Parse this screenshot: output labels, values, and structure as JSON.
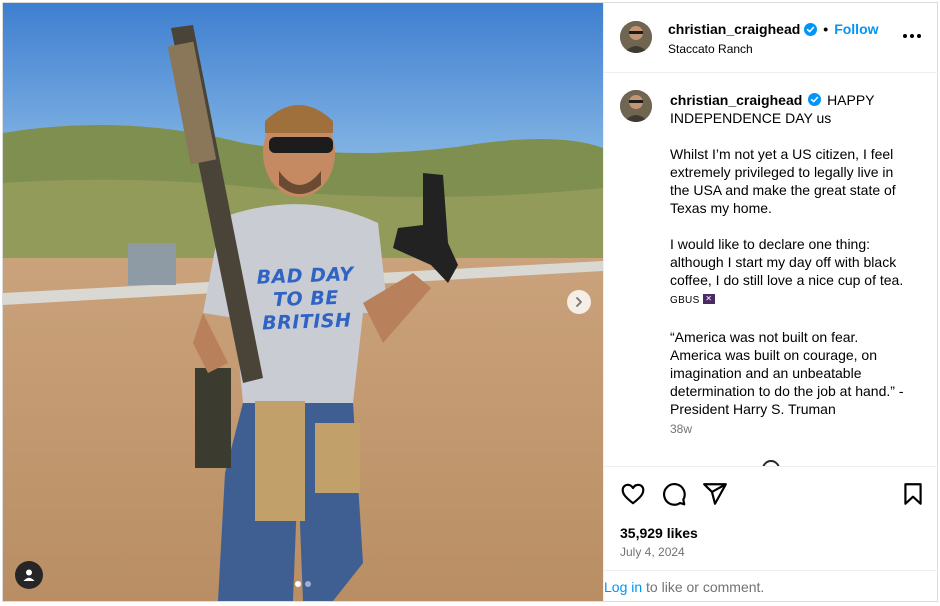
{
  "post": {
    "shirt_text": "BAD DAY\nTO BE\nBRITISH",
    "carousel_count": 2,
    "carousel_active": 1
  },
  "header": {
    "username": "christian_craighead",
    "separator": "•",
    "follow_label": "Follow",
    "location": "Staccato Ranch"
  },
  "caption": {
    "username": "christian_craighead",
    "line1": "HAPPY INDEPENDENCE DAY us",
    "para2": "Whilst I’m not yet a US citizen, I feel extremely privileged to legally live in the USA and make the great state of Texas my home.",
    "para3": "I would like to declare one thing: although I start my day off with black coffee, I do still love a nice cup of tea.",
    "para3_tag": "GBUS",
    "para4": "“America was not built on fear. America was built on courage, on imagination and an unbeatable determination to do the job at hand.” - President Harry S. Truman",
    "age": "38w"
  },
  "engagement": {
    "likes": "35,929 likes",
    "date": "July 4, 2024"
  },
  "login": {
    "link": "Log in",
    "rest": " to like or comment."
  },
  "colors": {
    "accent": "#0095f6",
    "verified": "#0095f6",
    "muted": "#737373"
  },
  "icons": [
    "verified-badge-icon",
    "more-options-icon",
    "chevron-right-icon",
    "user-tag-icon",
    "heart-icon",
    "comment-icon",
    "share-icon",
    "bookmark-icon"
  ]
}
